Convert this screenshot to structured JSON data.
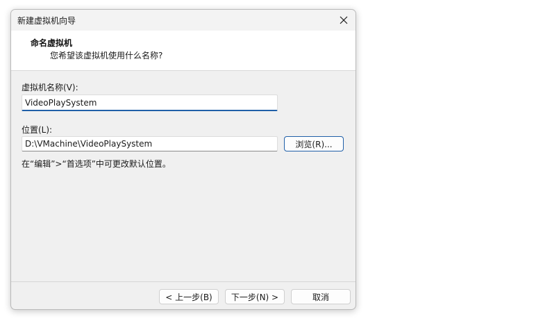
{
  "window": {
    "title": "新建虚拟机向导",
    "close_glyph": "×"
  },
  "header": {
    "title": "命名虚拟机",
    "subtitle": "您希望该虚拟机使用什么名称?"
  },
  "form": {
    "name_label": "虚拟机名称(V):",
    "name_value": "VideoPlaySystem",
    "location_label": "位置(L):",
    "location_value": "D:\\VMachine\\VideoPlaySystem",
    "browse_label": "浏览(R)...",
    "hint": "在“编辑”>“首选项”中可更改默认位置。"
  },
  "footer": {
    "back_label": "< 上一步(B)",
    "next_label": "下一步(N) >",
    "cancel_label": "取消"
  }
}
